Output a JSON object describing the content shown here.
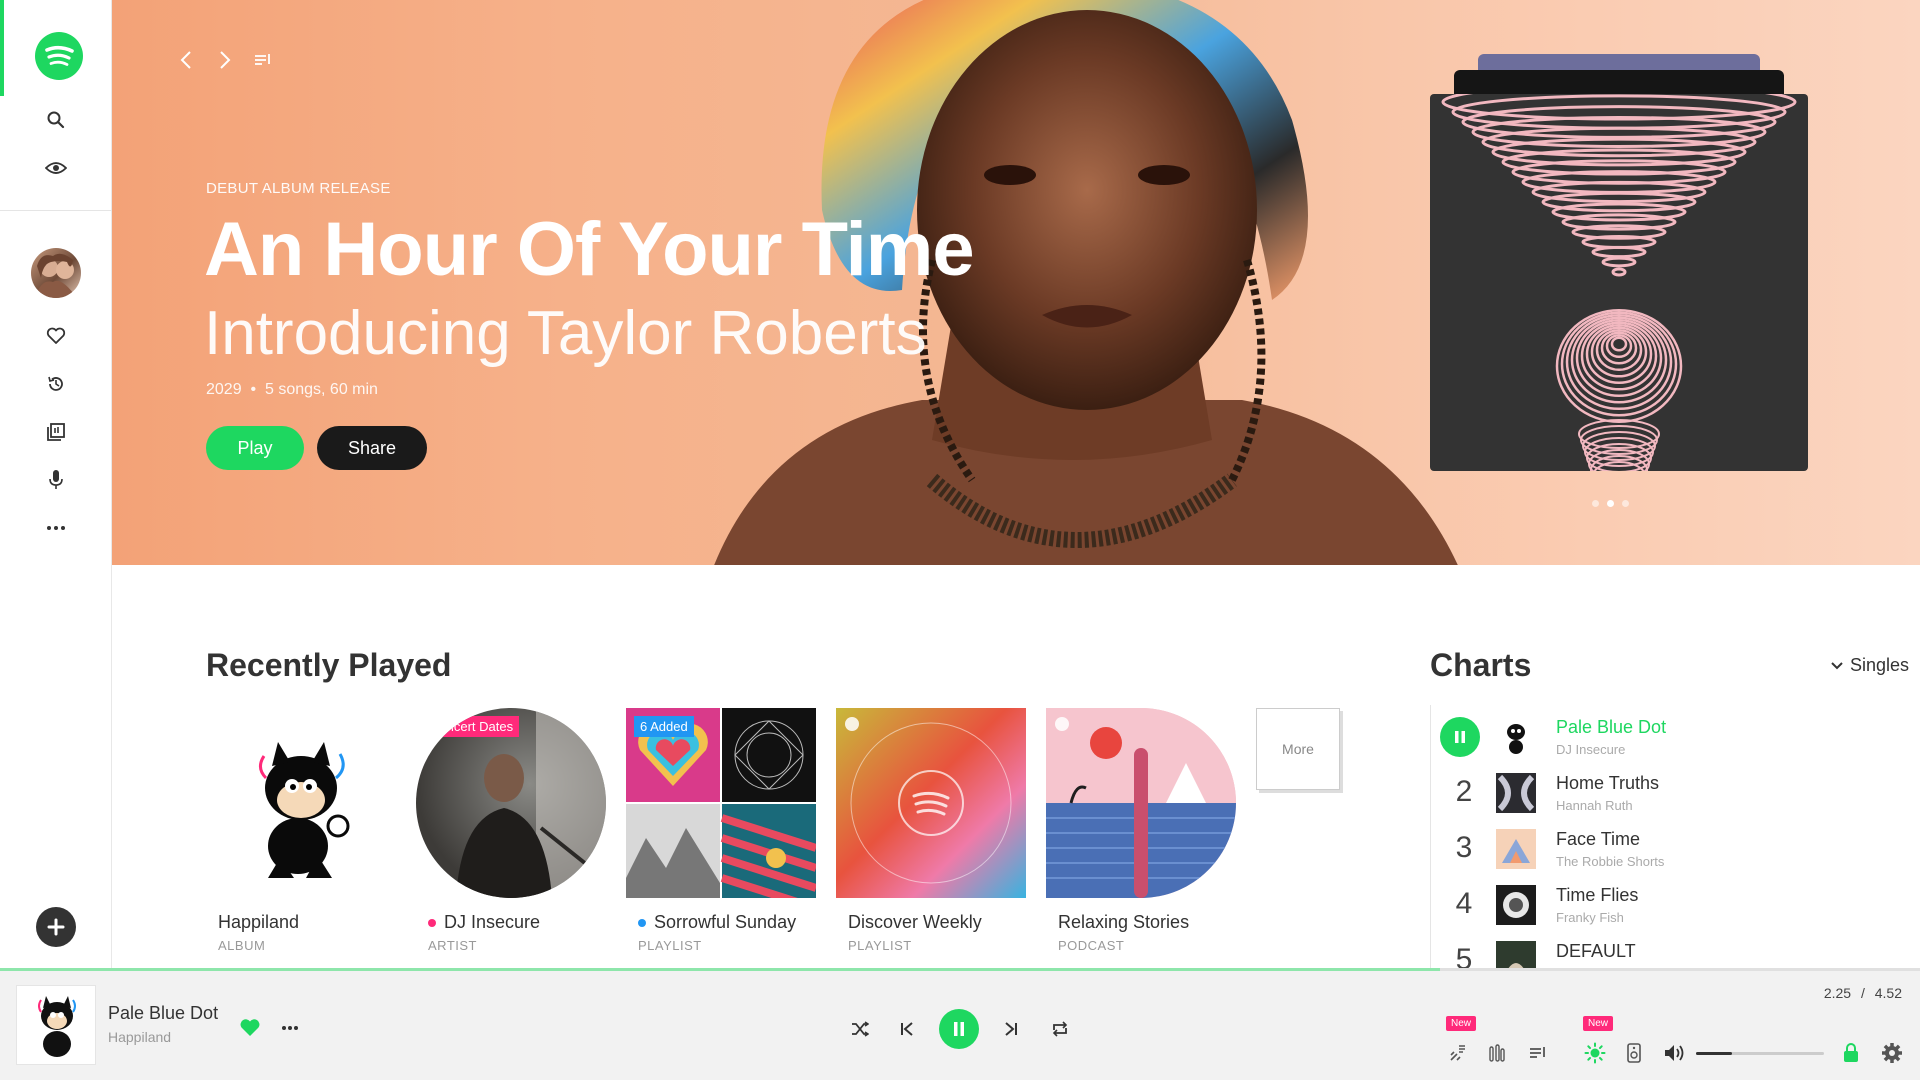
{
  "sidebar": {
    "logo": "spotify-logo",
    "icons": [
      "search-icon",
      "eye-icon",
      "heart-icon",
      "history-icon",
      "library-icon",
      "microphone-icon",
      "more-icon"
    ],
    "add_icon": "plus-icon"
  },
  "hero": {
    "eyebrow": "DEBUT ALBUM RELEASE",
    "title": "An Hour Of Your Time",
    "subtitle": "Introducing Taylor Roberts",
    "year": "2029",
    "details": "5 songs, 60 min",
    "play_label": "Play",
    "share_label": "Share",
    "slide_count": 3,
    "active_slide": 2
  },
  "recently_played": {
    "title": "Recently Played",
    "items": [
      {
        "title": "Happiland",
        "type": "ALBUM",
        "badge": "",
        "bullet": ""
      },
      {
        "title": "DJ Insecure",
        "type": "ARTIST",
        "badge": "Concert Dates",
        "bullet": "#ff2a7a"
      },
      {
        "title": "Sorrowful Sunday",
        "type": "PLAYLIST",
        "badge": "6 Added",
        "bullet": "#2196f3"
      },
      {
        "title": "Discover Weekly",
        "type": "PLAYLIST",
        "badge": "",
        "bullet": ""
      },
      {
        "title": "Relaxing Stories",
        "type": "PODCAST",
        "badge": "",
        "bullet": ""
      }
    ],
    "more_label": "More"
  },
  "charts": {
    "title": "Charts",
    "filter": "Singles",
    "rows": [
      {
        "rank": "1",
        "title": "Pale Blue Dot",
        "artist": "DJ Insecure",
        "playing": true
      },
      {
        "rank": "2",
        "title": "Home Truths",
        "artist": "Hannah Ruth",
        "playing": false
      },
      {
        "rank": "3",
        "title": "Face Time",
        "artist": "The Robbie Shorts",
        "playing": false
      },
      {
        "rank": "4",
        "title": "Time Flies",
        "artist": "Franky Fish",
        "playing": false
      },
      {
        "rank": "5",
        "title": "DEFAULT",
        "artist": "",
        "playing": false
      }
    ]
  },
  "player": {
    "track": "Pale Blue Dot",
    "album": "Happiland",
    "time_current": "2.25",
    "time_separator": "/",
    "time_total": "4.52",
    "progress": 0.75,
    "volume": 0.28,
    "new_badge": "New",
    "colors": {
      "accent": "#1ed760",
      "badge": "#ff2a7a"
    }
  }
}
